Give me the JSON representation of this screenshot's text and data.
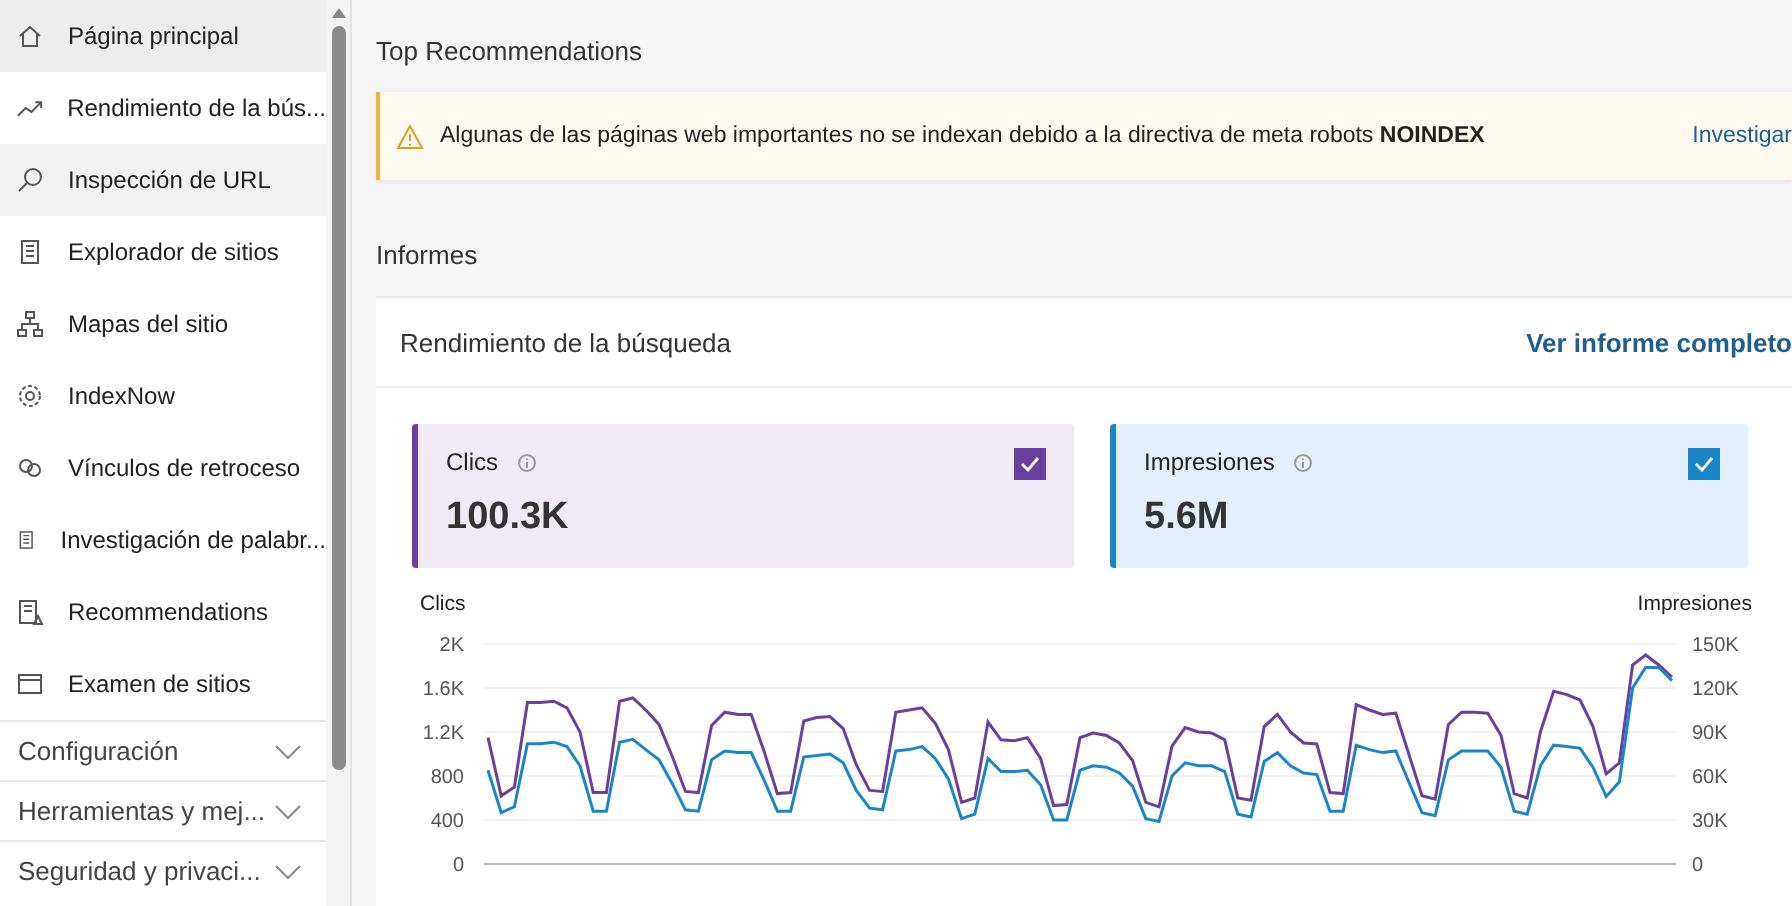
{
  "sidebar": {
    "items": [
      {
        "label": "Página principal",
        "selected": true,
        "highlighted": false
      },
      {
        "label": "Rendimiento de la bús...",
        "selected": false,
        "highlighted": false
      },
      {
        "label": "Inspección de URL",
        "selected": false,
        "highlighted": true
      },
      {
        "label": "Explorador de sitios",
        "selected": false,
        "highlighted": false
      },
      {
        "label": "Mapas del sitio",
        "selected": false,
        "highlighted": false
      },
      {
        "label": "IndexNow",
        "selected": false,
        "highlighted": false
      },
      {
        "label": "Vínculos de retroceso",
        "selected": false,
        "highlighted": false
      },
      {
        "label": "Investigación de palabr...",
        "selected": false,
        "highlighted": false
      },
      {
        "label": "Recommendations",
        "selected": false,
        "highlighted": false
      },
      {
        "label": "Examen de sitios",
        "selected": false,
        "highlighted": false
      }
    ],
    "sections": [
      {
        "label": "Configuración",
        "expanded": false
      },
      {
        "label": "Herramientas y mej...",
        "expanded": false
      },
      {
        "label": "Seguridad y privaci...",
        "expanded": false
      }
    ]
  },
  "recommendations": {
    "title": "Top Recommendations",
    "alert": {
      "text": "Algunas de las páginas web importantes no se indexan debido a la directiva de meta robots **NOINDEX**",
      "action": "Investigar"
    }
  },
  "reports": {
    "title": "Informes",
    "card": {
      "title": "Rendimiento de la búsqueda",
      "link": "Ver informe completo",
      "metrics": [
        {
          "label": "Clics",
          "value": "100.3K",
          "checked": true,
          "color": "#6b3fa0"
        },
        {
          "label": "Impresiones",
          "value": "5.6M",
          "checked": true,
          "color": "#1a86c9"
        }
      ],
      "chart_data": {
        "type": "line",
        "grid": true,
        "ylim": [
          0,
          2000
        ],
        "y2lim": [
          0,
          150000
        ],
        "yticks": [
          {
            "value": 0,
            "label": "0"
          },
          {
            "value": 400,
            "label": "400"
          },
          {
            "value": 800,
            "label": "800"
          },
          {
            "value": 1200,
            "label": "1.2K"
          },
          {
            "value": 1600,
            "label": "1.6K"
          },
          {
            "value": 2000,
            "label": "2K"
          }
        ],
        "y2ticks": [
          {
            "value": 0,
            "label": "0"
          },
          {
            "value": 30000,
            "label": "30K"
          },
          {
            "value": 60000,
            "label": "60K"
          },
          {
            "value": 90000,
            "label": "90K"
          },
          {
            "value": 120000,
            "label": "120K"
          },
          {
            "value": 150000,
            "label": "150K"
          }
        ],
        "series": [
          {
            "name": "Clics",
            "color": "#6b3fa0",
            "values": [
              1150,
              620,
              700,
              1470,
              1470,
              1480,
              1420,
              1200,
              650,
              650,
              1480,
              1510,
              1400,
              1270,
              980,
              660,
              650,
              1260,
              1380,
              1360,
              1360,
              1020,
              640,
              650,
              1300,
              1330,
              1340,
              1230,
              900,
              670,
              660,
              1380,
              1400,
              1420,
              1280,
              1040,
              560,
              600,
              1290,
              1130,
              1120,
              1150,
              960,
              530,
              540,
              1150,
              1190,
              1170,
              1100,
              940,
              560,
              520,
              1070,
              1240,
              1200,
              1190,
              1130,
              600,
              580,
              1250,
              1360,
              1200,
              1100,
              1090,
              650,
              640,
              1450,
              1400,
              1360,
              1370,
              1000,
              620,
              590,
              1270,
              1380,
              1380,
              1370,
              1170,
              640,
              600,
              1200,
              1570,
              1540,
              1490,
              1250,
              820,
              920,
              1810,
              1900,
              1810,
              1700
            ]
          },
          {
            "name": "Impresiones",
            "color": "#1a86c9",
            "axis": "y2",
            "values": [
              64000,
              35000,
              39000,
              82000,
              82000,
              83000,
              80000,
              67000,
              36000,
              36000,
              83000,
              85000,
              78000,
              71000,
              55000,
              37000,
              36000,
              71000,
              77000,
              76000,
              76000,
              57000,
              36000,
              36000,
              73000,
              74000,
              75000,
              69000,
              50000,
              38000,
              37000,
              77000,
              78000,
              80000,
              72000,
              58000,
              31000,
              34000,
              72000,
              63000,
              63000,
              64000,
              54000,
              30000,
              30000,
              64000,
              67000,
              66000,
              62000,
              53000,
              31000,
              29000,
              60000,
              69000,
              67000,
              67000,
              63000,
              34000,
              32000,
              70000,
              76000,
              67000,
              62000,
              61000,
              36000,
              36000,
              81000,
              78000,
              76000,
              77000,
              56000,
              35000,
              33000,
              71000,
              77000,
              77000,
              77000,
              66000,
              36000,
              34000,
              67000,
              81000,
              80000,
              79000,
              66000,
              46000,
              56000,
              120000,
              134000,
              134000,
              125000
            ]
          }
        ]
      }
    }
  }
}
